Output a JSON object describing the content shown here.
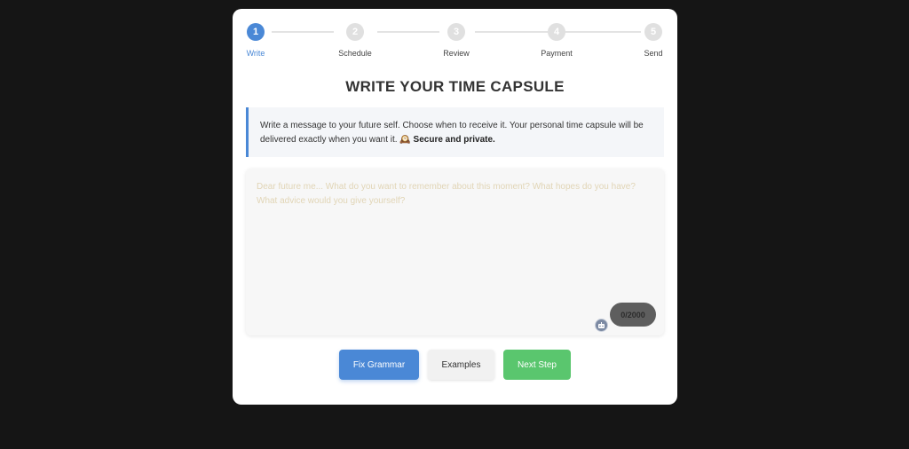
{
  "stepper": {
    "steps": [
      {
        "number": "1",
        "label": "Write"
      },
      {
        "number": "2",
        "label": "Schedule"
      },
      {
        "number": "3",
        "label": "Review"
      },
      {
        "number": "4",
        "label": "Payment"
      },
      {
        "number": "5",
        "label": "Send"
      }
    ],
    "active_step": 1
  },
  "title": "WRITE YOUR TIME CAPSULE",
  "info": {
    "text": "Write a message to your future self. Choose when to receive it. Your personal time capsule will be delivered exactly when you want it. 🕰️",
    "emphasis": "Secure and private."
  },
  "editor": {
    "value": "",
    "placeholder": "Dear future me... What do you want to remember about this moment? What hopes do you have? What advice would you give yourself?",
    "counter": "0/2000",
    "ai_icon": "robot-icon"
  },
  "buttons": {
    "fix_grammar": "Fix Grammar",
    "examples": "Examples",
    "next_step": "Next Step"
  },
  "colors": {
    "background": "#151515",
    "accent": "#4a88d6",
    "success": "#5ac66e"
  }
}
